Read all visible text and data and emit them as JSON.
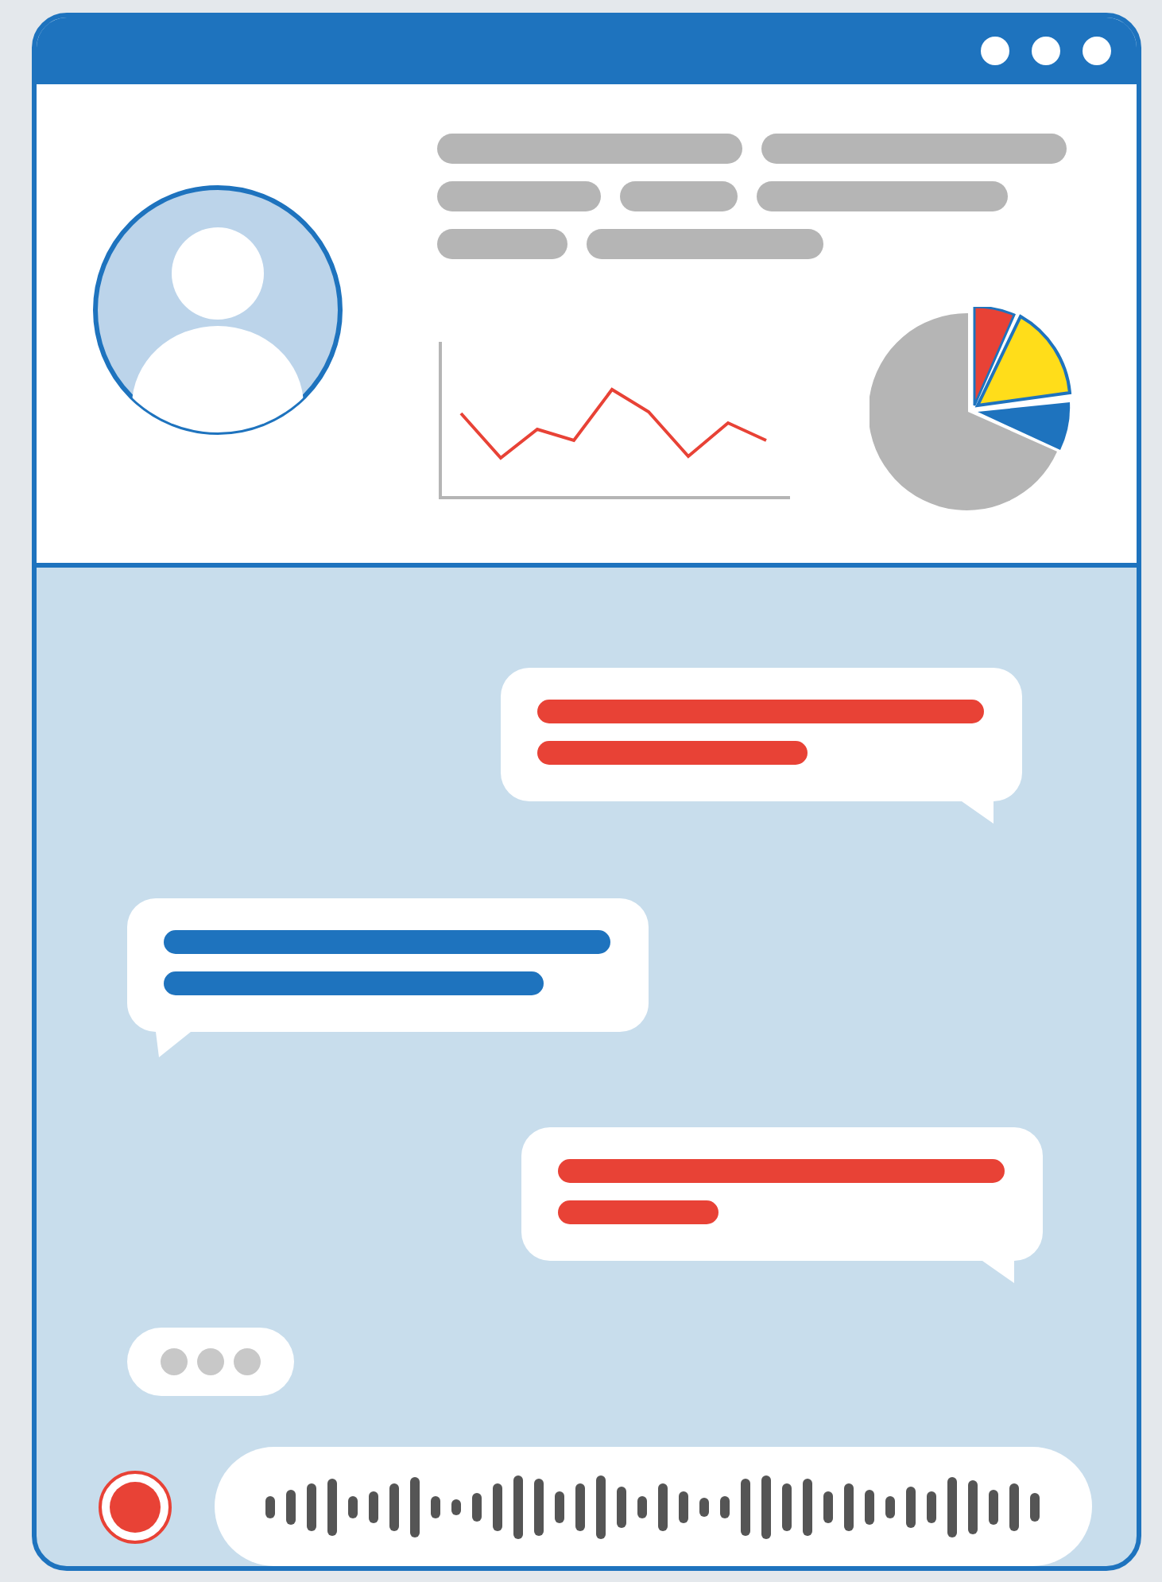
{
  "messages": [
    {
      "kind": "sent",
      "color": "#e84236"
    },
    {
      "kind": "received",
      "color": "#1e73be"
    },
    {
      "kind": "sent",
      "color": "#e84236"
    }
  ],
  "typing_indicator": {
    "shown": true
  },
  "voice_input": {
    "recording": true
  }
}
